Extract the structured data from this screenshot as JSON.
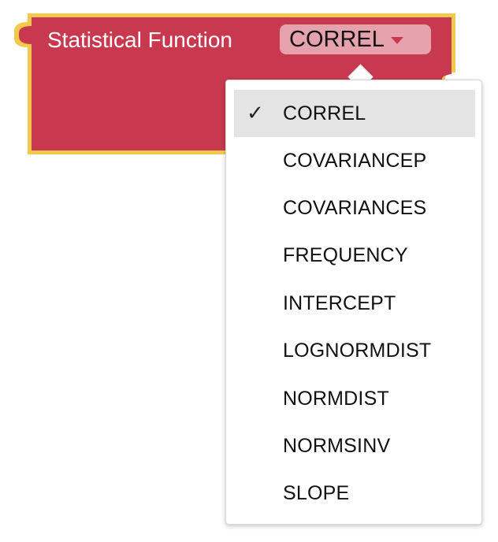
{
  "block": {
    "label": "Statistical Function",
    "field_value": "CORREL",
    "colors": {
      "fill": "#c8394f",
      "outline": "#f2c94c",
      "field_bg": "#e5a1ac"
    }
  },
  "menu": {
    "check_glyph": "✓",
    "items": [
      {
        "label": "CORREL",
        "selected": true
      },
      {
        "label": "COVARIANCEP",
        "selected": false
      },
      {
        "label": "COVARIANCES",
        "selected": false
      },
      {
        "label": "FREQUENCY",
        "selected": false
      },
      {
        "label": "INTERCEPT",
        "selected": false
      },
      {
        "label": "LOGNORMDIST",
        "selected": false
      },
      {
        "label": "NORMDIST",
        "selected": false
      },
      {
        "label": "NORMSINV",
        "selected": false
      },
      {
        "label": "SLOPE",
        "selected": false
      }
    ]
  },
  "icons": {
    "caret": "chevron-down-icon",
    "check": "check-icon"
  }
}
